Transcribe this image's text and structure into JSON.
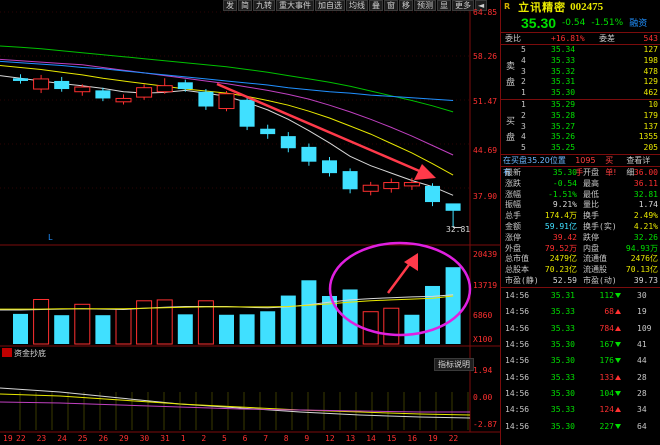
{
  "toolbar": {
    "buttons": [
      "发",
      "简",
      "九转",
      "重大事件",
      "加自选",
      "均线",
      "叠",
      "窗",
      "移",
      "预测",
      "显",
      "更多",
      "◄"
    ]
  },
  "price_axis": [
    "64.85",
    "58.26",
    "51.47",
    "44.69",
    "37.90",
    "32.81"
  ],
  "volume_axis": [
    "20439",
    "13719",
    "6860",
    "X100"
  ],
  "indicator_axis": [
    "1.94",
    "0.00",
    "-2.87"
  ],
  "date_axis": [
    "19",
    "22",
    "23",
    "24",
    "25",
    "26",
    "29",
    "30",
    "31",
    "1",
    "2",
    "5",
    "6",
    "7",
    "8",
    "9",
    "12",
    "13",
    "14",
    "15",
    "16",
    "19",
    "22"
  ],
  "chart_data": {
    "type": "candlestick",
    "low_marker": "32.81",
    "candles": [
      {
        "o": 55.0,
        "c": 54.6,
        "h": 55.6,
        "l": 54.2
      },
      {
        "o": 53.4,
        "c": 54.9,
        "h": 55.5,
        "l": 52.8
      },
      {
        "o": 54.6,
        "c": 53.4,
        "h": 55.2,
        "l": 53.0
      },
      {
        "o": 53.0,
        "c": 53.7,
        "h": 54.1,
        "l": 52.4
      },
      {
        "o": 53.2,
        "c": 52.0,
        "h": 53.6,
        "l": 51.6
      },
      {
        "o": 51.5,
        "c": 52.0,
        "h": 52.6,
        "l": 51.1
      },
      {
        "o": 52.2,
        "c": 53.6,
        "h": 54.1,
        "l": 51.8
      },
      {
        "o": 53.0,
        "c": 53.9,
        "h": 55.0,
        "l": 52.7
      },
      {
        "o": 54.4,
        "c": 53.4,
        "h": 54.8,
        "l": 53.0
      },
      {
        "o": 53.0,
        "c": 50.8,
        "h": 53.4,
        "l": 50.3
      },
      {
        "o": 50.5,
        "c": 52.7,
        "h": 53.1,
        "l": 50.1
      },
      {
        "o": 51.8,
        "c": 47.8,
        "h": 52.2,
        "l": 47.3
      },
      {
        "o": 47.5,
        "c": 46.7,
        "h": 48.1,
        "l": 46.0
      },
      {
        "o": 46.4,
        "c": 44.6,
        "h": 47.0,
        "l": 44.0
      },
      {
        "o": 44.8,
        "c": 42.6,
        "h": 45.3,
        "l": 42.0
      },
      {
        "o": 42.8,
        "c": 40.9,
        "h": 43.3,
        "l": 40.4
      },
      {
        "o": 41.2,
        "c": 38.5,
        "h": 41.6,
        "l": 37.9
      },
      {
        "o": 38.2,
        "c": 39.1,
        "h": 39.6,
        "l": 37.6
      },
      {
        "o": 38.6,
        "c": 39.5,
        "h": 40.1,
        "l": 38.0
      },
      {
        "o": 39.0,
        "c": 39.5,
        "h": 40.2,
        "l": 38.4
      },
      {
        "o": 39.0,
        "c": 36.6,
        "h": 39.4,
        "l": 36.0
      },
      {
        "o": 36.4,
        "c": 35.3,
        "h": 36.1,
        "l": 32.81
      }
    ],
    "ma": [
      {
        "color": "#d8d8d8",
        "values": [
          55.0,
          54.6,
          54.2,
          53.9,
          53.5,
          53.0,
          52.8,
          52.9,
          53.2,
          52.8,
          52.3,
          51.4,
          50.3,
          48.9,
          47.2,
          45.4,
          43.4,
          42.0,
          40.9,
          39.8,
          38.9,
          37.6
        ]
      },
      {
        "color": "#e8e800",
        "values": [
          56.6,
          56.3,
          55.9,
          55.5,
          55.0,
          54.6,
          54.2,
          53.8,
          53.4,
          53.1,
          52.8,
          52.3,
          51.7,
          51.0,
          50.1,
          49.1,
          47.9,
          46.7,
          45.3,
          43.9,
          42.3,
          40.6
        ]
      },
      {
        "color": "#c040c0",
        "values": [
          57.6,
          57.4,
          57.2,
          57.0,
          56.6,
          56.2,
          55.8,
          55.4,
          55.0,
          54.6,
          54.2,
          53.7,
          53.2,
          52.6,
          51.9,
          51.0,
          50.0,
          48.9,
          47.7,
          46.4,
          45.0,
          43.6
        ]
      },
      {
        "color": "#00c000",
        "values": [
          59.6,
          59.4,
          59.1,
          58.8,
          58.5,
          58.2,
          57.9,
          57.6,
          57.3,
          57.0,
          56.7,
          56.3,
          55.9,
          55.4,
          54.9,
          54.4,
          53.8,
          53.1,
          52.4,
          51.7,
          50.9,
          50.0
        ]
      },
      {
        "color": "#2090ff",
        "values": [
          57.3,
          57.1,
          56.9,
          56.6,
          56.4,
          56.1,
          55.8,
          55.5,
          55.2,
          54.9,
          54.6,
          54.3,
          54.0,
          53.6,
          53.3,
          53.0,
          52.8,
          52.5,
          52.3,
          52.1,
          51.9,
          51.7
        ]
      }
    ],
    "volume": [
      {
        "v": 6900,
        "up": false
      },
      {
        "v": 10200,
        "up": true
      },
      {
        "v": 6600,
        "up": false
      },
      {
        "v": 9100,
        "up": true
      },
      {
        "v": 6600,
        "up": false
      },
      {
        "v": 8000,
        "up": true
      },
      {
        "v": 9900,
        "up": true
      },
      {
        "v": 10100,
        "up": true
      },
      {
        "v": 6800,
        "up": false
      },
      {
        "v": 9900,
        "up": true
      },
      {
        "v": 6700,
        "up": false
      },
      {
        "v": 6800,
        "up": false
      },
      {
        "v": 7500,
        "up": false
      },
      {
        "v": 11100,
        "up": false
      },
      {
        "v": 14600,
        "up": false
      },
      {
        "v": 11000,
        "up": false
      },
      {
        "v": 12500,
        "up": false
      },
      {
        "v": 7400,
        "up": true
      },
      {
        "v": 8200,
        "up": true
      },
      {
        "v": 6700,
        "up": false
      },
      {
        "v": 13300,
        "up": false
      },
      {
        "v": 17600,
        "up": false
      }
    ],
    "vol_ma": [
      {
        "color": "#d8d8d8",
        "values": [
          7800,
          7900,
          8000,
          8100,
          8000,
          7900,
          8200,
          8400,
          8600,
          8600,
          8600,
          8400,
          8300,
          8500,
          9000,
          9600,
          10100,
          10400,
          10600,
          10800,
          10900,
          11300
        ]
      },
      {
        "color": "#e8e800",
        "values": [
          8000,
          8000,
          8100,
          8100,
          8100,
          8100,
          8200,
          8300,
          8400,
          8500,
          8500,
          8500,
          8500,
          8600,
          8900,
          9200,
          9600,
          9900,
          10100,
          10300,
          10500,
          11000
        ]
      }
    ],
    "volume_max": 22000
  },
  "panel": {
    "name": "立讯精密",
    "code": "002475",
    "price": "35.30",
    "change": "-0.54",
    "pct": "-1.51%",
    "financing": "融资",
    "weibi": {
      "label": "委比",
      "value": "+16.81%",
      "label2": "委差",
      "value2": "543"
    },
    "sell_tag": "卖盘",
    "buy_tag": "买盘",
    "asks": [
      {
        "lv": "5",
        "price": "35.34",
        "vol": "127"
      },
      {
        "lv": "4",
        "price": "35.33",
        "vol": "198"
      },
      {
        "lv": "3",
        "price": "35.32",
        "vol": "478"
      },
      {
        "lv": "2",
        "price": "35.31",
        "vol": "129"
      },
      {
        "lv": "1",
        "price": "35.30",
        "vol": "462"
      }
    ],
    "bids": [
      {
        "lv": "1",
        "price": "35.29",
        "vol": "10"
      },
      {
        "lv": "2",
        "price": "35.28",
        "vol": "179"
      },
      {
        "lv": "3",
        "price": "35.27",
        "vol": "137"
      },
      {
        "lv": "4",
        "price": "35.26",
        "vol": "1355"
      },
      {
        "lv": "5",
        "price": "35.25",
        "vol": "205"
      }
    ],
    "buy_info": {
      "text": "在买盘35.20位置有",
      "amount": "1095手",
      "action": "买单!",
      "detail": "查看详细"
    },
    "stats": [
      {
        "k1": "最新",
        "v1": "35.30",
        "c1": "grn",
        "k2": "开盘",
        "v2": "36.00",
        "c2": "red"
      },
      {
        "k1": "涨跌",
        "v1": "-0.54",
        "c1": "grn",
        "k2": "最高",
        "v2": "36.11",
        "c2": "red"
      },
      {
        "k1": "涨幅",
        "v1": "-1.51%",
        "c1": "grn",
        "k2": "最低",
        "v2": "32.81",
        "c2": "grn"
      },
      {
        "k1": "振幅",
        "v1": "9.21%",
        "c1": "wht",
        "k2": "量比",
        "v2": "1.74",
        "c2": "wht"
      },
      {
        "k1": "总手",
        "v1": "174.4万",
        "c1": "yel",
        "k2": "换手",
        "v2": "2.49%",
        "c2": "yel"
      },
      {
        "k1": "金额",
        "v1": "59.91亿",
        "c1": "cyan",
        "k2": "换手(实)",
        "v2": "4.21%",
        "c2": "yel"
      },
      {
        "k1": "涨停",
        "v1": "39.42",
        "c1": "red",
        "k2": "跌停",
        "v2": "32.26",
        "c2": "grn"
      },
      {
        "k1": "外盘",
        "v1": "79.52万",
        "c1": "red",
        "k2": "内盘",
        "v2": "94.93万",
        "c2": "grn"
      },
      {
        "k1": "总市值",
        "v1": "2479亿",
        "c1": "yel",
        "k2": "流通值",
        "v2": "2476亿",
        "c2": "yel"
      },
      {
        "k1": "总股本",
        "v1": "70.23亿",
        "c1": "yel",
        "k2": "流通股",
        "v2": "70.13亿",
        "c2": "yel"
      },
      {
        "k1": "市盈(静)",
        "v1": "52.59",
        "c1": "wht",
        "k2": "市盈(动)",
        "v2": "39.73",
        "c2": "wht"
      }
    ],
    "ticks": [
      {
        "t": "14:56",
        "p": "35.31",
        "v": "112",
        "dir": "dn",
        "n": "30"
      },
      {
        "t": "14:56",
        "p": "35.33",
        "v": "68",
        "dir": "up",
        "n": "19"
      },
      {
        "t": "14:56",
        "p": "35.33",
        "v": "784",
        "dir": "up",
        "n": "109"
      },
      {
        "t": "14:56",
        "p": "35.30",
        "v": "167",
        "dir": "dn",
        "n": "41"
      },
      {
        "t": "14:56",
        "p": "35.30",
        "v": "176",
        "dir": "dn",
        "n": "44"
      },
      {
        "t": "14:56",
        "p": "35.33",
        "v": "133",
        "dir": "up",
        "n": "28"
      },
      {
        "t": "14:56",
        "p": "35.30",
        "v": "104",
        "dir": "dn",
        "n": "28"
      },
      {
        "t": "14:56",
        "p": "35.33",
        "v": "124",
        "dir": "up",
        "n": "34"
      },
      {
        "t": "14:56",
        "p": "35.30",
        "v": "227",
        "dir": "dn",
        "n": "64"
      }
    ]
  },
  "indicator": {
    "label": "资金抄底",
    "button": "指标说明",
    "marker": "L"
  }
}
